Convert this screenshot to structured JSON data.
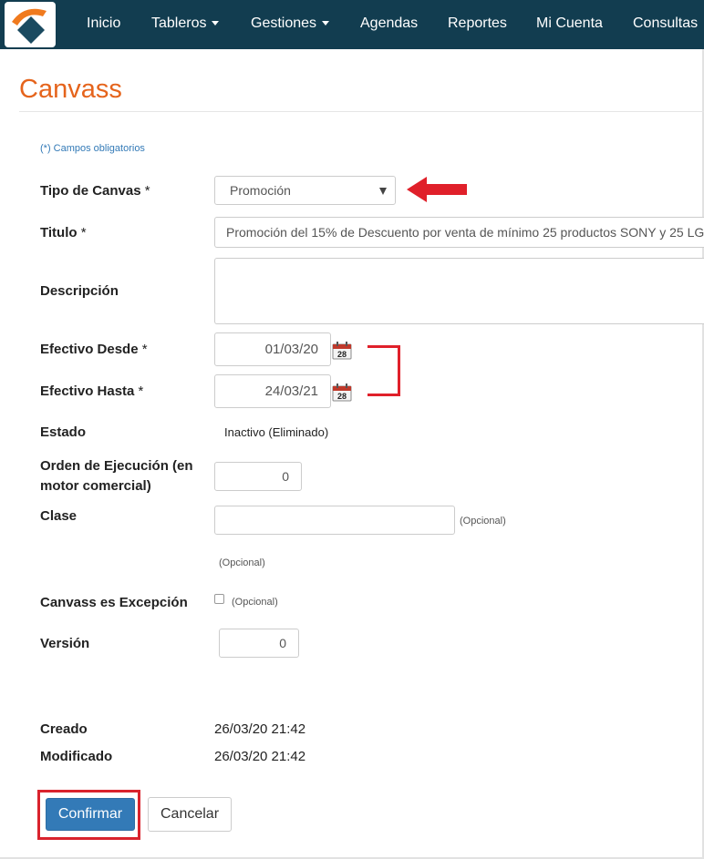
{
  "navbar": {
    "items": [
      {
        "label": "Inicio",
        "dropdown": false
      },
      {
        "label": "Tableros",
        "dropdown": true
      },
      {
        "label": "Gestiones",
        "dropdown": true
      },
      {
        "label": "Agendas",
        "dropdown": false
      },
      {
        "label": "Reportes",
        "dropdown": false
      },
      {
        "label": "Mi Cuenta",
        "dropdown": false
      },
      {
        "label": "Consultas",
        "dropdown": false
      }
    ]
  },
  "page": {
    "title": "Canvass",
    "required_note": "(*) Campos obligatorios"
  },
  "form": {
    "tipo": {
      "label": "Tipo de Canvas",
      "required_mark": " *",
      "value": "Promoción"
    },
    "titulo": {
      "label": "Titulo",
      "required_mark": " *",
      "value": "Promoción del 15% de Descuento por venta de mínimo 25 productos SONY y 25 LG"
    },
    "descripcion": {
      "label": "Descripción",
      "value": ""
    },
    "efectivo_desde": {
      "label": "Efectivo Desde",
      "required_mark": " *",
      "value": "01/03/20",
      "calendar_day": "28"
    },
    "efectivo_hasta": {
      "label": "Efectivo Hasta",
      "required_mark": " *",
      "value": "24/03/21",
      "calendar_day": "28"
    },
    "estado": {
      "label": "Estado",
      "value": "Inactivo (Eliminado)"
    },
    "orden": {
      "label_line1": "Orden de Ejecución (en",
      "label_line2": "motor comercial)",
      "value": "0"
    },
    "clase": {
      "label": "Clase",
      "value": "",
      "note": "(Opcional)",
      "note_below": "(Opcional)"
    },
    "excepcion": {
      "label": "Canvass es Excepción",
      "checked": false,
      "note": "(Opcional)"
    },
    "version": {
      "label": "Versión",
      "value": "0"
    },
    "creado": {
      "label": "Creado",
      "value": "26/03/20 21:42"
    },
    "modificado": {
      "label": "Modificado",
      "value": "26/03/20 21:42"
    }
  },
  "buttons": {
    "confirm": "Confirmar",
    "cancel": "Cancelar"
  },
  "colors": {
    "navbar": "#123d50",
    "title": "#e5641c",
    "primary": "#337ab7",
    "annotation": "#e0202a"
  }
}
